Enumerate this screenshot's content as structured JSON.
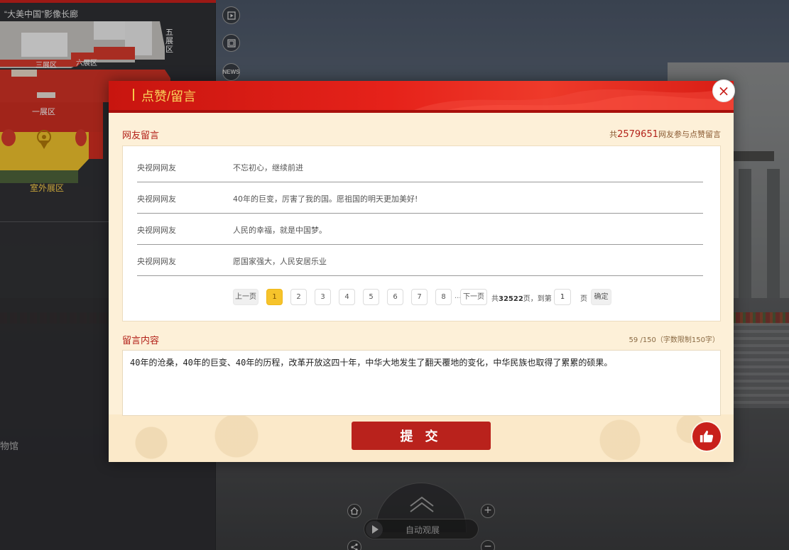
{
  "map": {
    "title": "“大美中国”影像长廊",
    "zones": {
      "zone5": "五展区",
      "zone3": "三展区",
      "zone6": "六展区",
      "zone1": "一展区",
      "outdoor": "室外展区"
    }
  },
  "left_panel": {
    "museum_text": "物馆"
  },
  "side_buttons": {
    "news_label": "NEWS"
  },
  "modal": {
    "title": "点赞/留言",
    "close_symbol": "×",
    "messages_section_label": "网友留言",
    "total": {
      "prefix": "共",
      "count": "2579651",
      "suffix": "网友参与点赞留言"
    },
    "messages": [
      {
        "user": "央视网网友",
        "text": "不忘初心，继续前进"
      },
      {
        "user": "央视网网友",
        "text": "40年的巨变，厉害了我的国。愿祖国的明天更加美好!"
      },
      {
        "user": "央视网网友",
        "text": "人民的幸福，就是中国梦。"
      },
      {
        "user": "央视网网友",
        "text": "愿国家强大，人民安居乐业"
      }
    ],
    "pagination": {
      "prev": "上一页",
      "pages": [
        "1",
        "2",
        "3",
        "4",
        "5",
        "6",
        "7",
        "8"
      ],
      "current": "1",
      "ellipsis": "...",
      "next": "下一页",
      "total_prefix": "共",
      "total_pages": "32522",
      "total_suffix": "页，到第",
      "goto_value": "1",
      "page_unit": "页",
      "confirm": "确定"
    },
    "compose_section_label": "留言内容",
    "counter": "59 /150（字数限制150字）",
    "compose_text": "40年的沧桑，40年的巨变、40年的历程，改革开放这四十年，中华大地发生了翻天覆地的变化，中华民族也取得了累累的硕果。",
    "submit_label": "提 交"
  },
  "bottom_nav": {
    "auto_tour_label": "自动观展",
    "plus_symbol": "+",
    "minus_symbol": "−"
  },
  "colors": {
    "brand_red": "#c8201b",
    "header_gold": "#f9d25a",
    "active_page": "#f6c32b",
    "modal_bg": "#fdf0d8"
  },
  "icons": {
    "close": "close-icon",
    "like": "thumbs-up-icon",
    "play": "play-icon",
    "home": "home-icon",
    "share": "share-icon",
    "location": "location-pin-icon",
    "video": "video-icon",
    "gallery": "gallery-icon"
  }
}
